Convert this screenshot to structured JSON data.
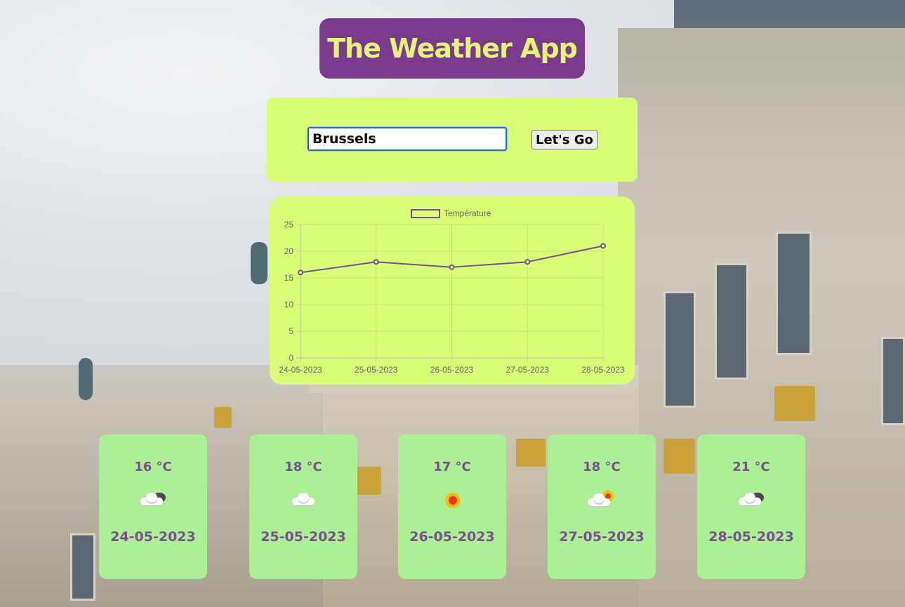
{
  "app": {
    "title": "The Weather App"
  },
  "search": {
    "value": "Brussels",
    "button_label": "Let's Go"
  },
  "chart_data": {
    "type": "line",
    "legend": [
      "Température"
    ],
    "categories": [
      "24-05-2023",
      "25-05-2023",
      "26-05-2023",
      "27-05-2023",
      "28-05-2023"
    ],
    "series": [
      {
        "name": "Température",
        "values": [
          16,
          18,
          17,
          18,
          21
        ],
        "color": "#7b4f8e"
      }
    ],
    "ylim": [
      0,
      25
    ],
    "yticks": [
      0,
      5,
      10,
      15,
      20,
      25
    ],
    "grid": true,
    "legend_position": "top"
  },
  "forecast": [
    {
      "temp": "16 °C",
      "icon": "cloud-dark-icon",
      "date": "24-05-2023"
    },
    {
      "temp": "18 °C",
      "icon": "cloud-icon",
      "date": "25-05-2023"
    },
    {
      "temp": "17 °C",
      "icon": "sun-icon",
      "date": "26-05-2023"
    },
    {
      "temp": "18 °C",
      "icon": "cloud-sun-icon",
      "date": "27-05-2023"
    },
    {
      "temp": "21 °C",
      "icon": "cloud-dark-icon",
      "date": "28-05-2023"
    }
  ],
  "colors": {
    "title_bg": "#7b3b8c",
    "title_text": "#e4f37c",
    "panel_bg": "#d9fd77",
    "card_bg": "#abf095",
    "card_text": "#7b4f8e",
    "line": "#7b4f8e"
  }
}
